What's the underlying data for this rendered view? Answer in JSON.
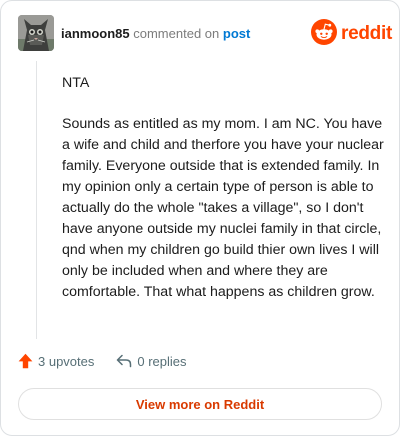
{
  "header": {
    "username": "ianmoon85",
    "action_text": "commented on",
    "post_link": "post",
    "avatar_icon": "cat-avatar-icon"
  },
  "brand": {
    "name": "reddit",
    "logo_icon": "reddit-snoo-icon",
    "color": "#ff4500"
  },
  "comment": {
    "paragraphs": [
      "NTA",
      "Sounds as entitled as my mom. I am NC. You have a wife and child and therfore you have your nuclear family. Everyone outside that is extended family. In my opinion only a certain type of person is able to actually do the whole \"takes a village\", so I don't have anyone outside my nuclei family in that circle, qnd when my children go build thier own lives I will only be included when and where they are comfortable. That what happens as children grow."
    ]
  },
  "actions": {
    "upvotes_label": "3 upvotes",
    "upvote_icon": "upvote-arrow-icon",
    "upvote_color": "#ff4500",
    "replies_label": "0 replies",
    "reply_icon": "reply-arrow-icon"
  },
  "view_more": {
    "label": "View more on Reddit",
    "color": "#d93a00"
  }
}
